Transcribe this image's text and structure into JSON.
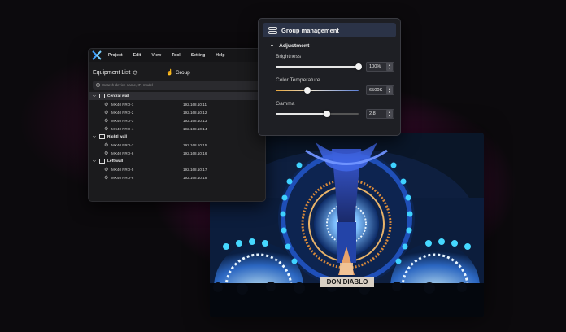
{
  "menubar": {
    "logo_icon": "app-logo-icon",
    "items": [
      "Project",
      "Edit",
      "View",
      "Tool",
      "Setting",
      "Help"
    ]
  },
  "equipment": {
    "title": "Equipment List",
    "refresh_icon": "refresh-icon",
    "group_label": "Group",
    "search_placeholder": "Search device name, IP, model",
    "groups": [
      {
        "name": "Central wall",
        "devices": [
          {
            "name": "MX40 PRO-1",
            "ip": "192.168.10.11"
          },
          {
            "name": "MX40 PRO-2",
            "ip": "192.168.10.12"
          },
          {
            "name": "MX40 PRO-3",
            "ip": "192.168.10.13"
          },
          {
            "name": "MX40 PRO-4",
            "ip": "192.168.10.14"
          }
        ]
      },
      {
        "name": "Rightl wall",
        "devices": [
          {
            "name": "MX40 PRO-7",
            "ip": "192.168.10.15"
          },
          {
            "name": "MX40 PRO-8",
            "ip": "192.168.10.16"
          }
        ]
      },
      {
        "name": "Left wall",
        "devices": [
          {
            "name": "MX40 PRO-5",
            "ip": "192.168.10.17"
          },
          {
            "name": "MX40 PRO-6",
            "ip": "192.168.10.18"
          }
        ]
      }
    ]
  },
  "group_management": {
    "title": "Group management",
    "section": "Adjustment",
    "params": [
      {
        "label": "Brightness",
        "value": "100%",
        "level": 1.0
      },
      {
        "label": "Color Temperature",
        "value": "6500K",
        "level": 0.38
      },
      {
        "label": "Gamma",
        "value": "2.8",
        "level": 0.62
      }
    ]
  },
  "photo": {
    "sign_text": "DON DIABLO"
  },
  "colors": {
    "accent_glow": "#be148c",
    "stage_blue": "#2a6cff",
    "stage_cyan": "#46d8ff",
    "panel_bg": "#1b1b1d"
  }
}
